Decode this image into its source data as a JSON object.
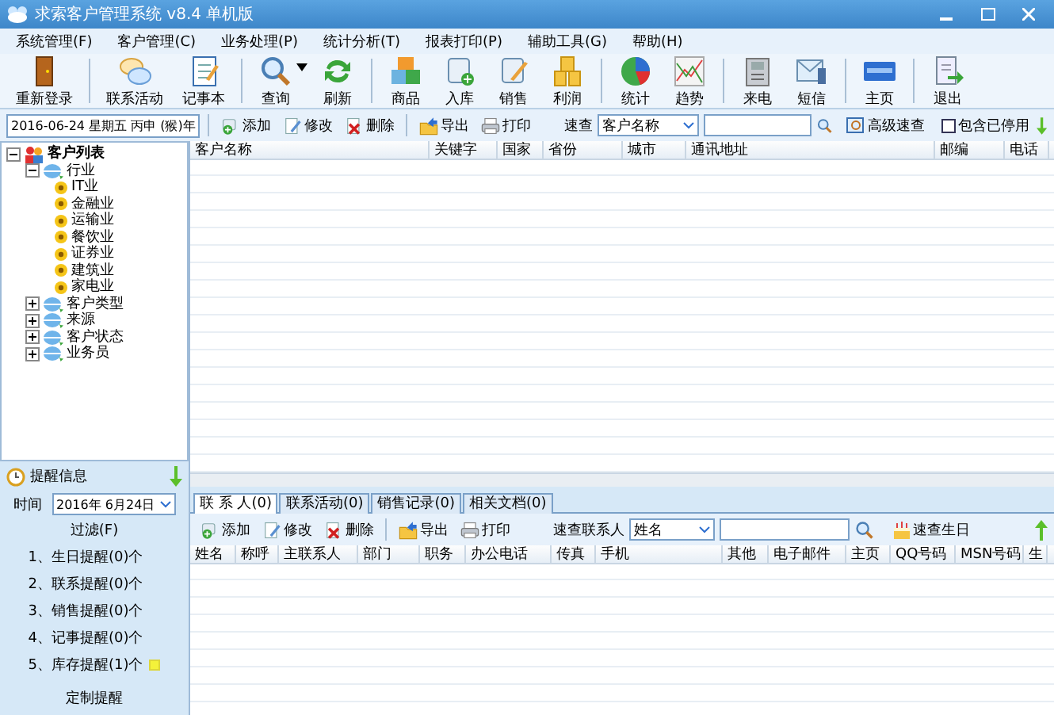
{
  "window": {
    "title": "求索客户管理系统 v8.4 单机版"
  },
  "menu": [
    "系统管理(F)",
    "客户管理(C)",
    "业务处理(P)",
    "统计分析(T)",
    "报表打印(P)",
    "辅助工具(G)",
    "帮助(H)"
  ],
  "toolbar": [
    "重新登录",
    "联系活动",
    "记事本",
    "查询",
    "刷新",
    "商品",
    "入库",
    "销售",
    "利润",
    "统计",
    "趋势",
    "来电",
    "短信",
    "主页",
    "退出"
  ],
  "date_field": {
    "value": "2016-06-24 星期五 丙申 (猴)年"
  },
  "actions": [
    "添加",
    "修改",
    "删除",
    "导出",
    "打印"
  ],
  "quick_search": {
    "label": "速查",
    "field": "客户名称",
    "advanced": "高级速查",
    "include_disabled": {
      "label": "包含已停用",
      "checked": false
    }
  },
  "tree": {
    "label": "客户列表",
    "expanded": true,
    "children": [
      {
        "label": "行业",
        "expanded": true,
        "children": [
          {
            "label": "IT业"
          },
          {
            "label": "金融业"
          },
          {
            "label": "运输业"
          },
          {
            "label": "餐饮业"
          },
          {
            "label": "证券业"
          },
          {
            "label": "建筑业"
          },
          {
            "label": "家电业"
          }
        ]
      },
      {
        "label": "客户类型",
        "expanded": false
      },
      {
        "label": "来源",
        "expanded": false
      },
      {
        "label": "客户状态",
        "expanded": false
      },
      {
        "label": "业务员",
        "expanded": false
      }
    ]
  },
  "customer_table": {
    "columns": [
      "客户名称",
      "关键字",
      "国家",
      "省份",
      "城市",
      "通讯地址",
      "邮编",
      "电话"
    ]
  },
  "reminders": {
    "title": "提醒信息",
    "time_label": "时间",
    "date": "2016年 6月24日",
    "filter": "过滤(F)",
    "items": [
      {
        "text": "1、生日提醒(0)个",
        "flag": false
      },
      {
        "text": "2、联系提醒(0)个",
        "flag": false
      },
      {
        "text": "3、销售提醒(0)个",
        "flag": false
      },
      {
        "text": "4、记事提醒(0)个",
        "flag": false
      },
      {
        "text": "5、库存提醒(1)个",
        "flag": true
      }
    ],
    "custom": "定制提醒"
  },
  "detail_tabs": [
    {
      "label": "联 系 人(0)",
      "selected": true
    },
    {
      "label": "联系活动(0)",
      "selected": false
    },
    {
      "label": "销售记录(0)",
      "selected": false
    },
    {
      "label": "相关文档(0)",
      "selected": false
    }
  ],
  "detail_actions": [
    "添加",
    "修改",
    "删除",
    "导出",
    "打印"
  ],
  "contact_search": {
    "label": "速查联系人",
    "field": "姓名",
    "birthday": "速查生日"
  },
  "contact_table": {
    "columns": [
      "姓名",
      "称呼",
      "主联系人",
      "部门",
      "职务",
      "办公电话",
      "传真",
      "手机",
      "其他",
      "电子邮件",
      "主页",
      "QQ号码",
      "MSN号码",
      "生"
    ]
  }
}
